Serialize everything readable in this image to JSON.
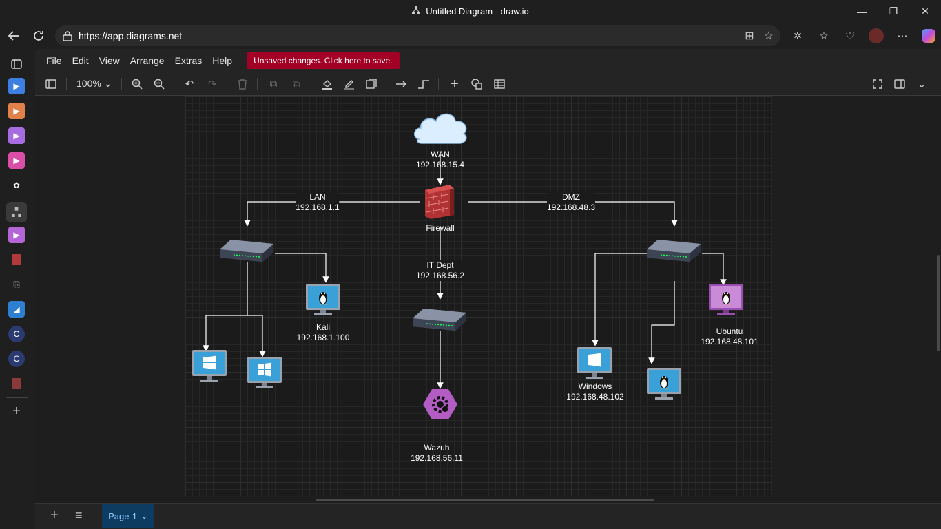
{
  "window": {
    "title": "Untitled Diagram - draw.io",
    "minimize": "—",
    "maximize": "❐",
    "close": "✕"
  },
  "browser": {
    "url": "https://app.diagrams.net"
  },
  "menu": {
    "items": [
      "File",
      "Edit",
      "View",
      "Arrange",
      "Extras",
      "Help"
    ],
    "unsaved": "Unsaved changes. Click here to save."
  },
  "toolbar": {
    "zoom": "100%"
  },
  "diagram": {
    "wan": "WAN\n192.168.15.4",
    "firewall": "Firewall",
    "lan": "LAN\n192.168.1.1",
    "dmz": "DMZ\n192.168.48.3",
    "itdept": "IT Dept\n192.168.56.2",
    "kali": "Kali\n192.168.1.100",
    "wazuh": "Wazuh\n192.168.56.11",
    "windows": "Windows\n192.168.48.102",
    "ubuntu": "Ubuntu\n192.168.48.101"
  },
  "pages": {
    "current": "Page-1"
  },
  "colors": {
    "unsaved_bg": "#a20025",
    "page_tab_bg": "#0e3c60",
    "monitor_blue": "#3aa0d8",
    "ubuntu_purple": "#9a4fb0",
    "wazuh_purple": "#b35cc4"
  }
}
